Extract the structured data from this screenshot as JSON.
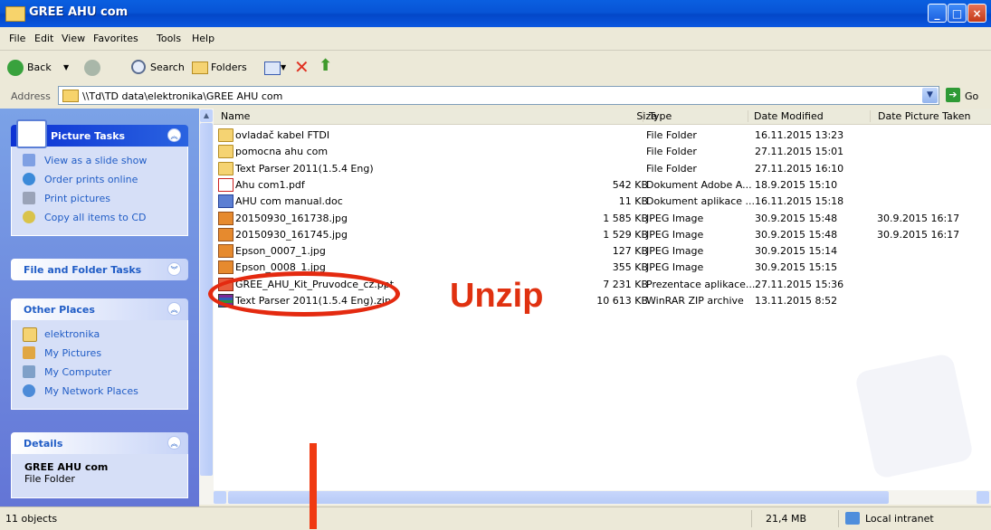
{
  "window": {
    "title": "GREE AHU com"
  },
  "menu": [
    "File",
    "Edit",
    "View",
    "Favorites",
    "Tools",
    "Help"
  ],
  "toolbar": {
    "back": "Back",
    "search": "Search",
    "folders": "Folders"
  },
  "address": {
    "label": "Address",
    "path": "\\\\Td\\TD data\\elektronika\\GREE AHU com",
    "go": "Go"
  },
  "left": {
    "picture_tasks": {
      "title": "Picture Tasks",
      "items": [
        "View as a slide show",
        "Order prints online",
        "Print pictures",
        "Copy all items to CD"
      ]
    },
    "file_folder_tasks": {
      "title": "File and Folder Tasks"
    },
    "other_places": {
      "title": "Other Places",
      "items": [
        "elektronika",
        "My Pictures",
        "My Computer",
        "My Network Places"
      ]
    },
    "details": {
      "title": "Details",
      "name": "GREE AHU com",
      "kind": "File Folder"
    }
  },
  "columns": {
    "name": "Name",
    "size": "Size",
    "type": "Type",
    "modified": "Date Modified",
    "taken": "Date Picture Taken"
  },
  "files": [
    {
      "icon": "folder",
      "name": "ovladač kabel FTDI",
      "size": "",
      "type": "File Folder",
      "modified": "16.11.2015 13:23",
      "taken": ""
    },
    {
      "icon": "folder",
      "name": "pomocna ahu com",
      "size": "",
      "type": "File Folder",
      "modified": "27.11.2015 15:01",
      "taken": ""
    },
    {
      "icon": "folder",
      "name": "Text Parser 2011(1.5.4 Eng)",
      "size": "",
      "type": "File Folder",
      "modified": "27.11.2015 16:10",
      "taken": ""
    },
    {
      "icon": "pdf",
      "name": "Ahu com1.pdf",
      "size": "542 KB",
      "type": "Dokument Adobe A...",
      "modified": "18.9.2015 15:10",
      "taken": ""
    },
    {
      "icon": "doc",
      "name": "AHU com manual.doc",
      "size": "11 KB",
      "type": "Dokument aplikace ...",
      "modified": "16.11.2015 15:18",
      "taken": ""
    },
    {
      "icon": "jpg",
      "name": "20150930_161738.jpg",
      "size": "1 585 KB",
      "type": "JPEG Image",
      "modified": "30.9.2015 15:48",
      "taken": "30.9.2015 16:17"
    },
    {
      "icon": "jpg",
      "name": "20150930_161745.jpg",
      "size": "1 529 KB",
      "type": "JPEG Image",
      "modified": "30.9.2015 15:48",
      "taken": "30.9.2015 16:17"
    },
    {
      "icon": "jpg",
      "name": "Epson_0007_1.jpg",
      "size": "127 KB",
      "type": "JPEG Image",
      "modified": "30.9.2015 15:14",
      "taken": ""
    },
    {
      "icon": "jpg",
      "name": "Epson_0008_1.jpg",
      "size": "355 KB",
      "type": "JPEG Image",
      "modified": "30.9.2015 15:15",
      "taken": ""
    },
    {
      "icon": "ppt",
      "name": "GREE_AHU_Kit_Pruvodce_cz.ppt",
      "size": "7 231 KB",
      "type": "Prezentace aplikace...",
      "modified": "27.11.2015 15:36",
      "taken": ""
    },
    {
      "icon": "zip",
      "name": "Text Parser 2011(1.5.4 Eng).zip",
      "size": "10 613 KB",
      "type": "WinRAR ZIP archive",
      "modified": "13.11.2015 8:52",
      "taken": ""
    }
  ],
  "annotation": {
    "text": "Unzip",
    "color": "#e03110"
  },
  "status": {
    "count": "11 objects",
    "size": "21,4 MB",
    "zone": "Local intranet"
  }
}
